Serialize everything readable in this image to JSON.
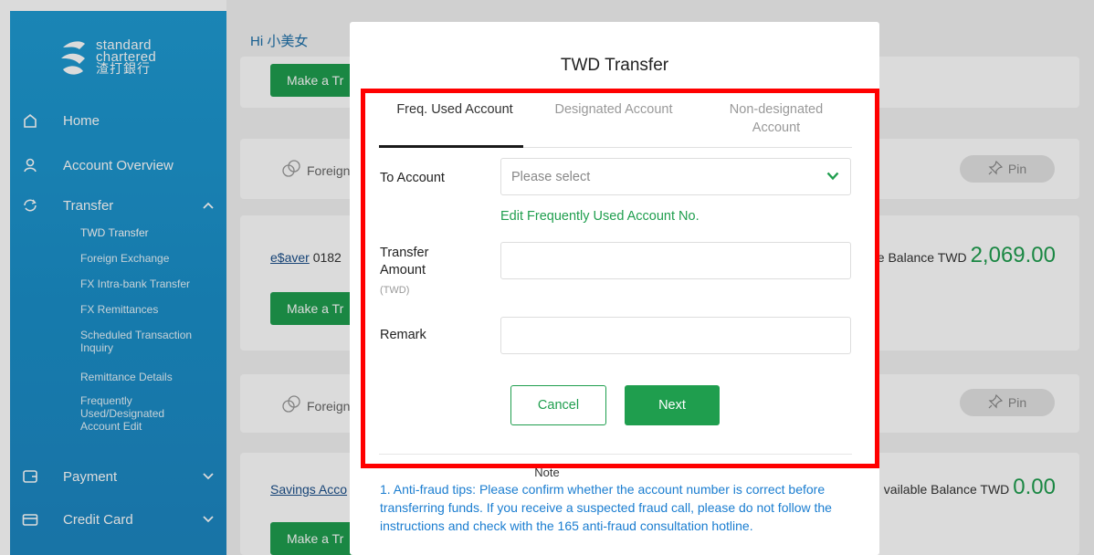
{
  "sidebar": {
    "logo": {
      "line1": "standard",
      "line2": "chartered",
      "line3": "渣打銀行"
    },
    "items": [
      {
        "label": "Home",
        "icon": "home-icon"
      },
      {
        "label": "Account Overview",
        "icon": "user-icon"
      },
      {
        "label": "Transfer",
        "icon": "transfer-icon",
        "chevron": "^"
      },
      {
        "label": "Payment",
        "icon": "payment-icon",
        "chevron": "v"
      },
      {
        "label": "Credit Card",
        "icon": "credit-card-icon",
        "chevron": "v"
      }
    ],
    "transfer_sub": [
      "TWD Transfer",
      "Foreign Exchange",
      "FX Intra-bank Transfer",
      "FX Remittances",
      "Scheduled Transaction Inquiry",
      "Remittance Details",
      "Frequently Used/Designated Account Edit"
    ]
  },
  "main": {
    "greeting": "Hi 小美女",
    "make_transfer_label": "Make a Tr",
    "foreign_label": "Foreign",
    "pin_label": "Pin",
    "esaver": {
      "name": "e$aver",
      "number": "0182"
    },
    "esaver_balance": {
      "prefix": "e Balance TWD",
      "amount": "2,069.00"
    },
    "savings": {
      "name": "Savings Acco"
    },
    "savings_balance": {
      "prefix": "vailable Balance TWD",
      "amount": "0.00"
    }
  },
  "modal": {
    "title": "TWD Transfer",
    "tabs": [
      {
        "label": "Freq. Used Account",
        "active": true
      },
      {
        "label": "Designated Account",
        "active": false
      },
      {
        "label": "Non-designated Account",
        "active": false
      }
    ],
    "to_account": {
      "label": "To Account",
      "placeholder": "Please select"
    },
    "edit_link": "Edit Frequently Used Account No.",
    "transfer_amount": {
      "label_line1": "Transfer",
      "label_line2": "Amount",
      "unit": "(TWD)"
    },
    "remark": {
      "label": "Remark"
    },
    "cancel_label": "Cancel",
    "next_label": "Next",
    "note_title": "Note",
    "note_text": "1. Anti-fraud tips: Please confirm whether the account number is correct before transferring funds. If you receive a suspected fraud call, please do not follow the instructions and check with the 165 anti-fraud consultation hotline."
  },
  "colors": {
    "brand_green": "#1f9e4e",
    "sidebar_blue": "#1f9bd3",
    "highlight_red": "#ff0000",
    "note_blue": "#1a7dd0"
  }
}
